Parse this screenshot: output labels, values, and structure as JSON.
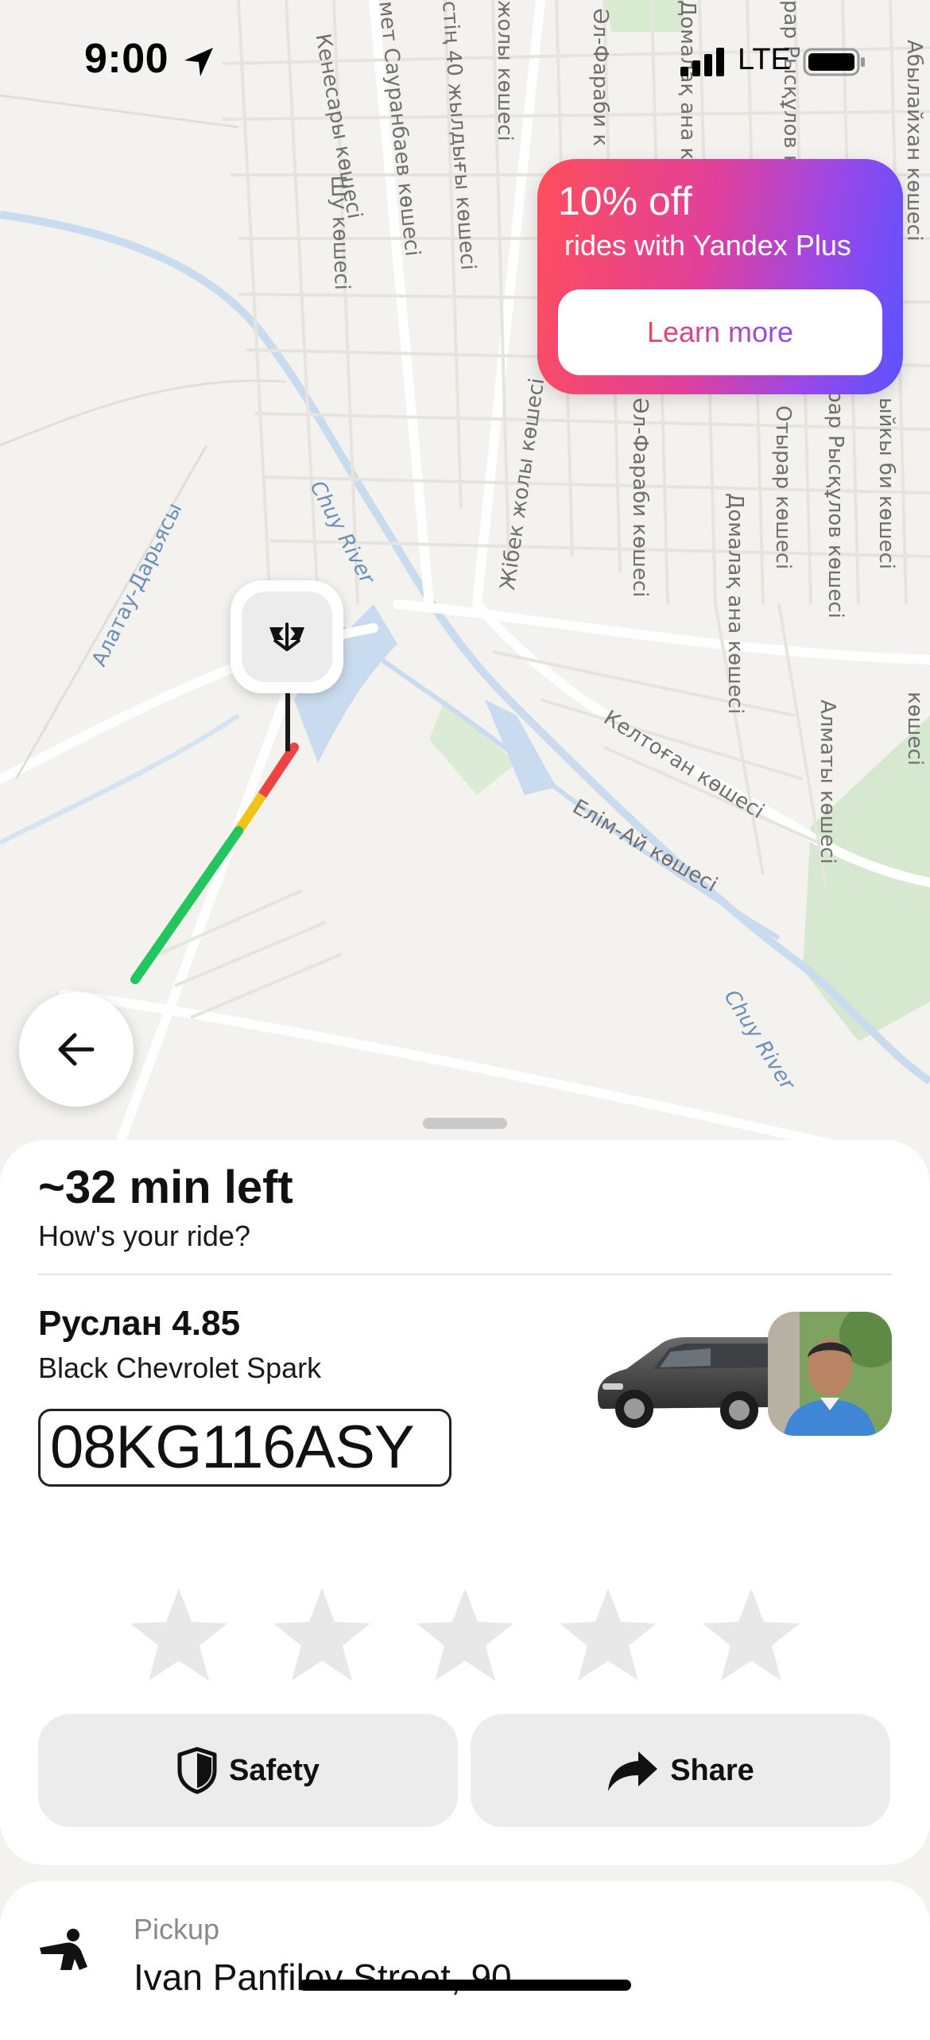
{
  "status_bar": {
    "time": "9:00",
    "network": "LTE",
    "icons": [
      "location-arrow-icon",
      "signal-icon",
      "battery-icon"
    ]
  },
  "map": {
    "street_labels": [
      "Кенесары көшесі",
      "мет Сауранбаев көшесі",
      "стің 40 жылдығы көшесі",
      "жолы көшесі",
      "Әл-Фараби к",
      "Домалақ ана к",
      "рар Рысқұлов к",
      "Абылайхан көшесі",
      "Шу көшесі",
      "Жібек жолы көшесі",
      "Әл-Фараби көшесі",
      "Домалақ ана көшесі",
      "Отырар көшесі",
      "рар Рысқұлов көшесі",
      "ыйкы би көшесі",
      "Алатау-Дарьясы",
      "Келтоған көшесі",
      "Елім-Ай көшесі",
      "Алматы көшесі",
      "көшесі"
    ],
    "river_labels": [
      "Chuy River",
      "Chuy River"
    ],
    "colors": {
      "land": "#f4f2ee",
      "water": "#c9dcef",
      "road": "#ffffff",
      "route_green": "#22c55e",
      "route_yellow": "#f2c215",
      "route_red": "#ef4343"
    }
  },
  "promo": {
    "title": "10% off",
    "subtitle": "rides with Yandex Plus",
    "button": "Learn more"
  },
  "destination_pin": {
    "icon": "destination-flag-icon"
  },
  "back_button": {
    "icon": "arrow-left-icon"
  },
  "ride": {
    "time_left": "~32 min left",
    "question": "How's your ride?",
    "driver_name_rating": "Руслан 4.85",
    "car_model": "Black Chevrolet Spark",
    "license_plate": "08KG116ASY",
    "rating_stars": 0,
    "rating_max": 5
  },
  "actions": {
    "safety": {
      "label": "Safety",
      "icon": "shield-icon"
    },
    "share": {
      "label": "Share",
      "icon": "share-arrow-icon"
    }
  },
  "pickup": {
    "label": "Pickup",
    "address": "Ivan Panfilov Street, 90",
    "icon": "person-waving-icon"
  }
}
